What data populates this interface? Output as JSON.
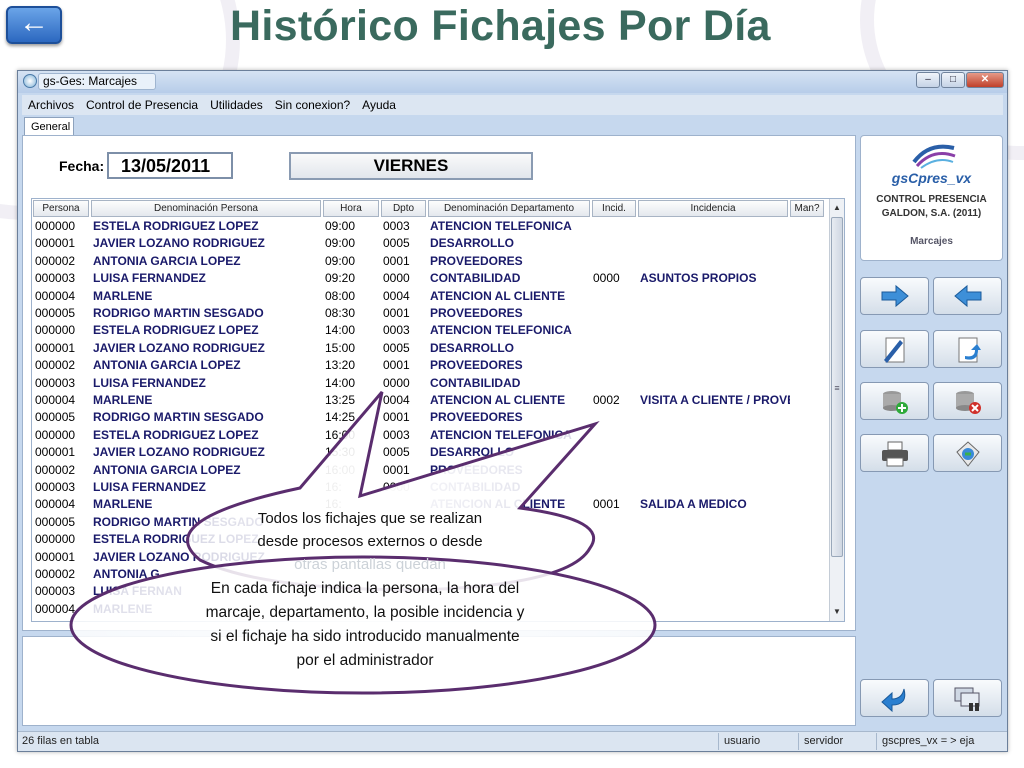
{
  "slide": {
    "title": "Histórico Fichajes Por Día",
    "back_icon": "left-arrow-icon"
  },
  "window": {
    "title": "gs-Ges: Marcajes",
    "controls": [
      "minimize",
      "maximize",
      "close"
    ]
  },
  "menu": [
    "Archivos",
    "Control de Presencia",
    "Utilidades",
    "Sin conexion?",
    "Ayuda"
  ],
  "tabs": [
    "General"
  ],
  "form": {
    "fecha_label": "Fecha:",
    "fecha_value": "13/05/2011",
    "day_value": "VIERNES"
  },
  "grid": {
    "columns": [
      "Persona",
      "Denominación Persona",
      "Hora",
      "Dpto",
      "Denominación Departamento",
      "Incid.",
      "Incidencia",
      "Man?"
    ],
    "rows": [
      [
        "000000",
        "ESTELA RODRIGUEZ LOPEZ",
        "09:00",
        "0003",
        "ATENCION TELEFONICA",
        "",
        ""
      ],
      [
        "000001",
        "JAVIER LOZANO RODRIGUEZ",
        "09:00",
        "0005",
        "DESARROLLO",
        "",
        ""
      ],
      [
        "000002",
        "ANTONIA GARCIA LOPEZ",
        "09:00",
        "0001",
        "PROVEEDORES",
        "",
        ""
      ],
      [
        "000003",
        "LUISA FERNANDEZ",
        "09:20",
        "0000",
        "CONTABILIDAD",
        "0000",
        "ASUNTOS PROPIOS"
      ],
      [
        "000004",
        "MARLENE",
        "08:00",
        "0004",
        "ATENCION AL CLIENTE",
        "",
        ""
      ],
      [
        "000005",
        "RODRIGO MARTIN SESGADO",
        "08:30",
        "0001",
        "PROVEEDORES",
        "",
        ""
      ],
      [
        "000000",
        "ESTELA RODRIGUEZ LOPEZ",
        "14:00",
        "0003",
        "ATENCION TELEFONICA",
        "",
        ""
      ],
      [
        "000001",
        "JAVIER LOZANO RODRIGUEZ",
        "15:00",
        "0005",
        "DESARROLLO",
        "",
        ""
      ],
      [
        "000002",
        "ANTONIA GARCIA LOPEZ",
        "13:20",
        "0001",
        "PROVEEDORES",
        "",
        ""
      ],
      [
        "000003",
        "LUISA FERNANDEZ",
        "14:00",
        "0000",
        "CONTABILIDAD",
        "",
        ""
      ],
      [
        "000004",
        "MARLENE",
        "13:25",
        "0004",
        "ATENCION AL CLIENTE",
        "0002",
        "VISITA A CLIENTE / PROVE"
      ],
      [
        "000005",
        "RODRIGO MARTIN SESGADO",
        "14:25",
        "0001",
        "PROVEEDORES",
        "",
        ""
      ],
      [
        "000000",
        "ESTELA RODRIGUEZ LOPEZ",
        "16:00",
        "0003",
        "ATENCION TELEFONICA",
        "",
        ""
      ],
      [
        "000001",
        "JAVIER LOZANO RODRIGUEZ",
        "15:30",
        "0005",
        "DESARROLLO",
        "",
        ""
      ],
      [
        "000002",
        "ANTONIA GARCIA LOPEZ",
        "16:00",
        "0001",
        "PROVEEDORES",
        "",
        ""
      ],
      [
        "000003",
        "LUISA FERNANDEZ",
        "16:",
        "0000",
        "CONTABILIDAD",
        "",
        ""
      ],
      [
        "000004",
        "MARLENE",
        "16:",
        "",
        "ATENCION AL CLIENTE",
        "0001",
        "SALIDA A MEDICO"
      ],
      [
        "000005",
        "RODRIGO MARTIN SESGADO",
        "",
        "",
        "",
        "",
        ""
      ],
      [
        "000000",
        "ESTELA RODRIGUEZ LOPEZ",
        "",
        "",
        "",
        "",
        ""
      ],
      [
        "000001",
        "JAVIER LOZANO RODRIGUEZ",
        "",
        "",
        "",
        "",
        ""
      ],
      [
        "000002",
        "ANTONIA G",
        "",
        "",
        "",
        "",
        ""
      ],
      [
        "000003",
        "LUISA FERNAN",
        "",
        "",
        "",
        "",
        ""
      ],
      [
        "000004",
        "MARLENE",
        "",
        "",
        "",
        "",
        ""
      ]
    ]
  },
  "side_card": {
    "logo_text": "gsCpres_vx",
    "line1": "CONTROL PRESENCIA",
    "line2": "GALDON, S.A. (2011)",
    "line3": "Marcajes"
  },
  "side_buttons": [
    {
      "name": "next-arrow-icon"
    },
    {
      "name": "previous-arrow-icon"
    },
    {
      "name": "edit-document-icon"
    },
    {
      "name": "undo-document-icon"
    },
    {
      "name": "add-database-icon"
    },
    {
      "name": "delete-database-icon"
    },
    {
      "name": "printer-icon"
    },
    {
      "name": "export-icon"
    },
    {
      "name": "return-icon"
    },
    {
      "name": "windows-icon"
    }
  ],
  "status": {
    "rows": "26 filas en tabla",
    "usuario": "usuario",
    "servidor": "servidor",
    "app": "gscpres_vx = > eja"
  },
  "callouts": {
    "bubble1_line1": "Todos los fichajes que se realizan",
    "bubble1_line2": "desde procesos externos o desde",
    "bubble1_line3": "otras pantallas quedan",
    "bubble2_line1": "En cada fichaje indica la persona, la hora del",
    "bubble2_line2": "marcaje, departamento, la posible incidencia y",
    "bubble2_line3": "si el fichaje ha sido introducido manualmente",
    "bubble2_line4": "por el administrador"
  },
  "colors": {
    "title": "#3a6a5e",
    "bubble_border": "#5a2d6e",
    "grid_text": "#1a1a6a"
  }
}
